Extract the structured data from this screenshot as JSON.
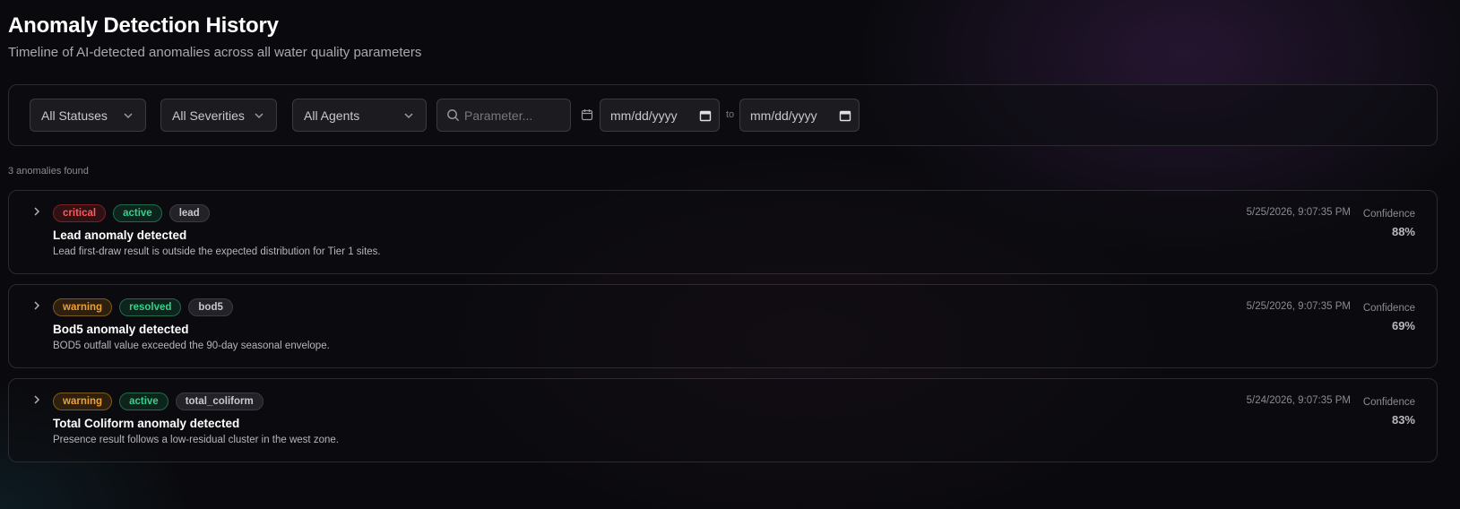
{
  "header": {
    "title": "Anomaly Detection History",
    "subtitle": "Timeline of AI-detected anomalies across all water quality parameters"
  },
  "filters": {
    "status": "All Statuses",
    "severity": "All Severities",
    "agent": "All Agents",
    "search_placeholder": "Parameter...",
    "date_from": "mm/dd/yyyy",
    "date_to": "mm/dd/yyyy",
    "to_label": "to"
  },
  "results": {
    "count_label": "3 anomalies found"
  },
  "anomalies": [
    {
      "severity": "critical",
      "status": "active",
      "parameter": "lead",
      "title": "Lead anomaly detected",
      "description": "Lead first-draw result is outside the expected distribution for Tier 1 sites.",
      "timestamp": "5/25/2026, 9:07:35 PM",
      "confidence_label": "Confidence",
      "confidence": "88%"
    },
    {
      "severity": "warning",
      "status": "resolved",
      "parameter": "bod5",
      "title": "Bod5 anomaly detected",
      "description": "BOD5 outfall value exceeded the 90-day seasonal envelope.",
      "timestamp": "5/25/2026, 9:07:35 PM",
      "confidence_label": "Confidence",
      "confidence": "69%"
    },
    {
      "severity": "warning",
      "status": "active",
      "parameter": "total_coliform",
      "title": "Total Coliform anomaly detected",
      "description": "Presence result follows a low-residual cluster in the west zone.",
      "timestamp": "5/24/2026, 9:07:35 PM",
      "confidence_label": "Confidence",
      "confidence": "83%"
    }
  ],
  "colors": {
    "critical": "#ff5a5a",
    "warning": "#f0a030",
    "active": "#35d08a",
    "resolved": "#35d08a"
  }
}
